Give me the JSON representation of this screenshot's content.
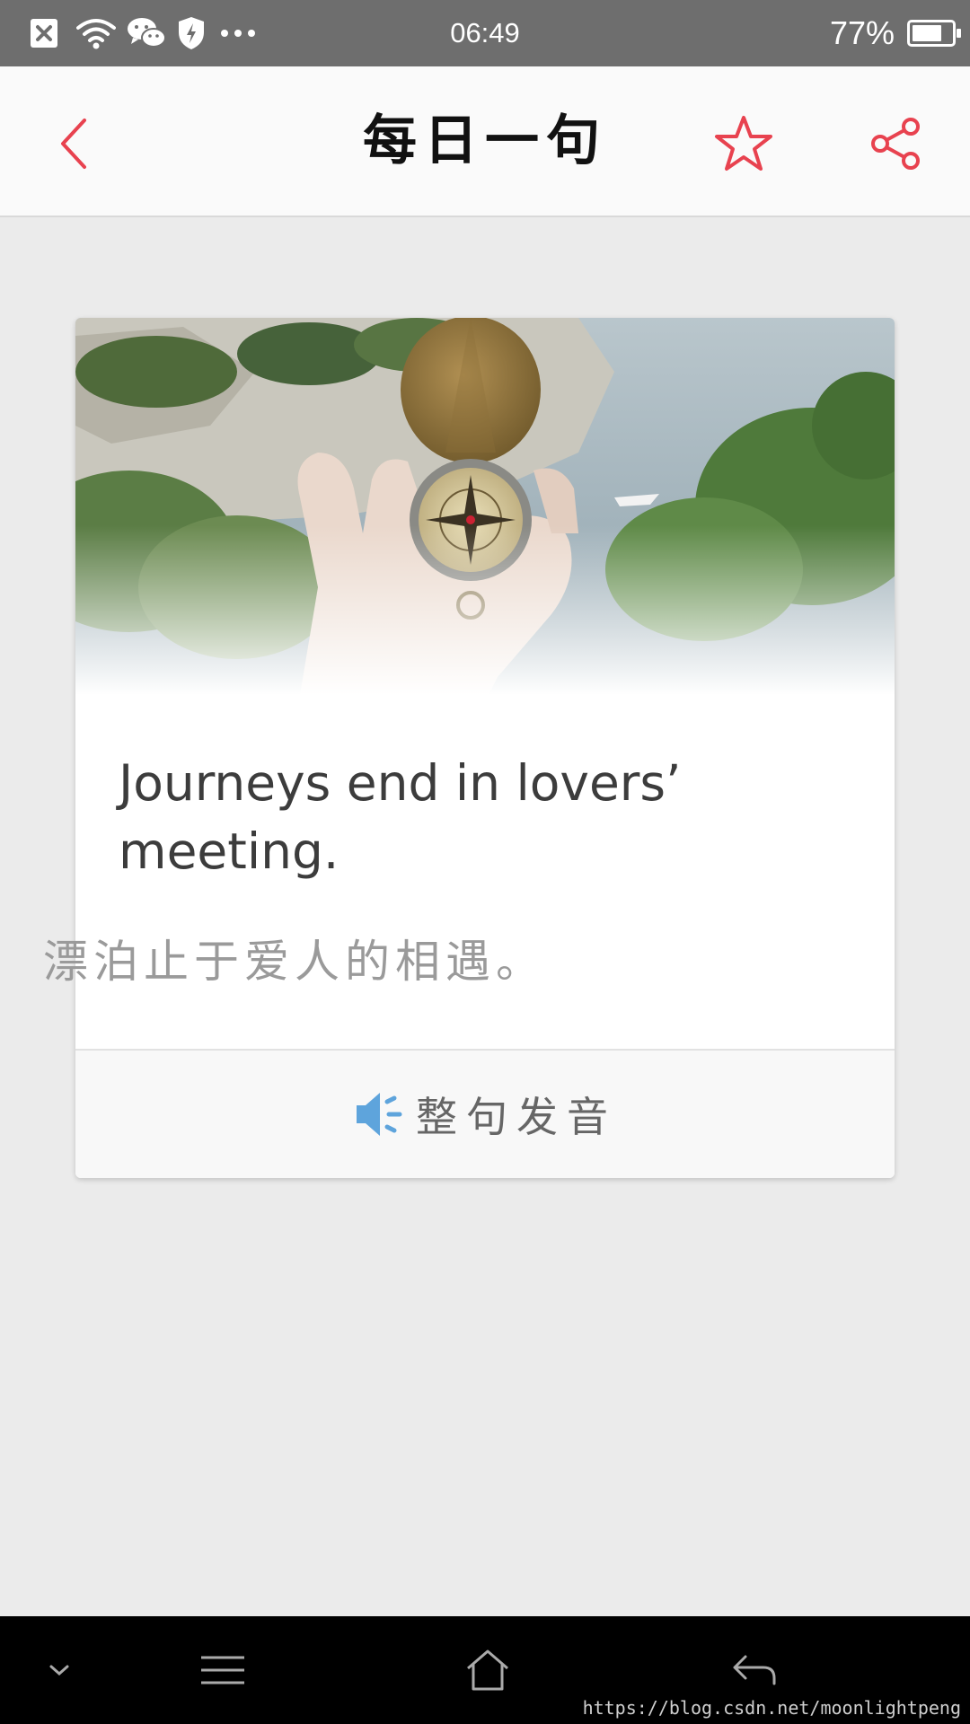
{
  "status_bar": {
    "time": "06:49",
    "battery_percent": "77%",
    "battery_level": 0.77,
    "icons": [
      "close-notification-icon",
      "wifi-icon",
      "wechat-icon",
      "shield-icon",
      "more-dots-icon",
      "battery-icon"
    ]
  },
  "app_bar": {
    "title": "每日一句",
    "back_icon": "chevron-left-icon",
    "favorite_icon": "star-icon",
    "share_icon": "share-icon",
    "accent_color": "#e8424f"
  },
  "card": {
    "image_description_icon": "compass-photo",
    "quote_en": "Journeys end in lovers’ meeting.",
    "quote_zh": "漂泊止于爱人的相遇。",
    "play_label": "整句发音",
    "play_icon": "speaker-icon",
    "play_icon_color": "#5ea4dc"
  },
  "nav_bar": {
    "icons": [
      "chevron-down-icon",
      "menu-icon",
      "home-icon",
      "back-arrow-icon"
    ]
  },
  "watermark": "https://blog.csdn.net/moonlightpeng"
}
